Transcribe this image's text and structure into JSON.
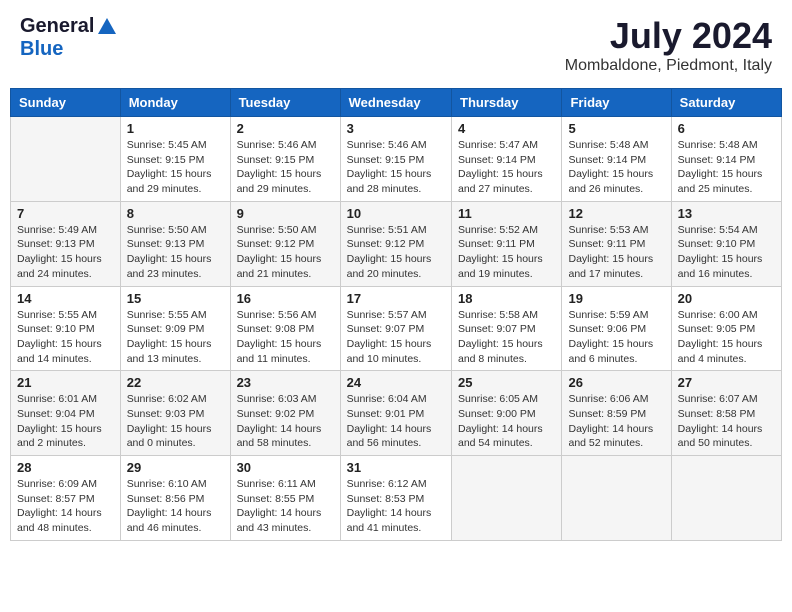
{
  "header": {
    "logo_general": "General",
    "logo_blue": "Blue",
    "month_title": "July 2024",
    "location": "Mombaldone, Piedmont, Italy"
  },
  "calendar": {
    "days_of_week": [
      "Sunday",
      "Monday",
      "Tuesday",
      "Wednesday",
      "Thursday",
      "Friday",
      "Saturday"
    ],
    "weeks": [
      [
        {
          "day": "",
          "info": ""
        },
        {
          "day": "1",
          "info": "Sunrise: 5:45 AM\nSunset: 9:15 PM\nDaylight: 15 hours\nand 29 minutes."
        },
        {
          "day": "2",
          "info": "Sunrise: 5:46 AM\nSunset: 9:15 PM\nDaylight: 15 hours\nand 29 minutes."
        },
        {
          "day": "3",
          "info": "Sunrise: 5:46 AM\nSunset: 9:15 PM\nDaylight: 15 hours\nand 28 minutes."
        },
        {
          "day": "4",
          "info": "Sunrise: 5:47 AM\nSunset: 9:14 PM\nDaylight: 15 hours\nand 27 minutes."
        },
        {
          "day": "5",
          "info": "Sunrise: 5:48 AM\nSunset: 9:14 PM\nDaylight: 15 hours\nand 26 minutes."
        },
        {
          "day": "6",
          "info": "Sunrise: 5:48 AM\nSunset: 9:14 PM\nDaylight: 15 hours\nand 25 minutes."
        }
      ],
      [
        {
          "day": "7",
          "info": "Sunrise: 5:49 AM\nSunset: 9:13 PM\nDaylight: 15 hours\nand 24 minutes."
        },
        {
          "day": "8",
          "info": "Sunrise: 5:50 AM\nSunset: 9:13 PM\nDaylight: 15 hours\nand 23 minutes."
        },
        {
          "day": "9",
          "info": "Sunrise: 5:50 AM\nSunset: 9:12 PM\nDaylight: 15 hours\nand 21 minutes."
        },
        {
          "day": "10",
          "info": "Sunrise: 5:51 AM\nSunset: 9:12 PM\nDaylight: 15 hours\nand 20 minutes."
        },
        {
          "day": "11",
          "info": "Sunrise: 5:52 AM\nSunset: 9:11 PM\nDaylight: 15 hours\nand 19 minutes."
        },
        {
          "day": "12",
          "info": "Sunrise: 5:53 AM\nSunset: 9:11 PM\nDaylight: 15 hours\nand 17 minutes."
        },
        {
          "day": "13",
          "info": "Sunrise: 5:54 AM\nSunset: 9:10 PM\nDaylight: 15 hours\nand 16 minutes."
        }
      ],
      [
        {
          "day": "14",
          "info": "Sunrise: 5:55 AM\nSunset: 9:10 PM\nDaylight: 15 hours\nand 14 minutes."
        },
        {
          "day": "15",
          "info": "Sunrise: 5:55 AM\nSunset: 9:09 PM\nDaylight: 15 hours\nand 13 minutes."
        },
        {
          "day": "16",
          "info": "Sunrise: 5:56 AM\nSunset: 9:08 PM\nDaylight: 15 hours\nand 11 minutes."
        },
        {
          "day": "17",
          "info": "Sunrise: 5:57 AM\nSunset: 9:07 PM\nDaylight: 15 hours\nand 10 minutes."
        },
        {
          "day": "18",
          "info": "Sunrise: 5:58 AM\nSunset: 9:07 PM\nDaylight: 15 hours\nand 8 minutes."
        },
        {
          "day": "19",
          "info": "Sunrise: 5:59 AM\nSunset: 9:06 PM\nDaylight: 15 hours\nand 6 minutes."
        },
        {
          "day": "20",
          "info": "Sunrise: 6:00 AM\nSunset: 9:05 PM\nDaylight: 15 hours\nand 4 minutes."
        }
      ],
      [
        {
          "day": "21",
          "info": "Sunrise: 6:01 AM\nSunset: 9:04 PM\nDaylight: 15 hours\nand 2 minutes."
        },
        {
          "day": "22",
          "info": "Sunrise: 6:02 AM\nSunset: 9:03 PM\nDaylight: 15 hours\nand 0 minutes."
        },
        {
          "day": "23",
          "info": "Sunrise: 6:03 AM\nSunset: 9:02 PM\nDaylight: 14 hours\nand 58 minutes."
        },
        {
          "day": "24",
          "info": "Sunrise: 6:04 AM\nSunset: 9:01 PM\nDaylight: 14 hours\nand 56 minutes."
        },
        {
          "day": "25",
          "info": "Sunrise: 6:05 AM\nSunset: 9:00 PM\nDaylight: 14 hours\nand 54 minutes."
        },
        {
          "day": "26",
          "info": "Sunrise: 6:06 AM\nSunset: 8:59 PM\nDaylight: 14 hours\nand 52 minutes."
        },
        {
          "day": "27",
          "info": "Sunrise: 6:07 AM\nSunset: 8:58 PM\nDaylight: 14 hours\nand 50 minutes."
        }
      ],
      [
        {
          "day": "28",
          "info": "Sunrise: 6:09 AM\nSunset: 8:57 PM\nDaylight: 14 hours\nand 48 minutes."
        },
        {
          "day": "29",
          "info": "Sunrise: 6:10 AM\nSunset: 8:56 PM\nDaylight: 14 hours\nand 46 minutes."
        },
        {
          "day": "30",
          "info": "Sunrise: 6:11 AM\nSunset: 8:55 PM\nDaylight: 14 hours\nand 43 minutes."
        },
        {
          "day": "31",
          "info": "Sunrise: 6:12 AM\nSunset: 8:53 PM\nDaylight: 14 hours\nand 41 minutes."
        },
        {
          "day": "",
          "info": ""
        },
        {
          "day": "",
          "info": ""
        },
        {
          "day": "",
          "info": ""
        }
      ]
    ]
  }
}
